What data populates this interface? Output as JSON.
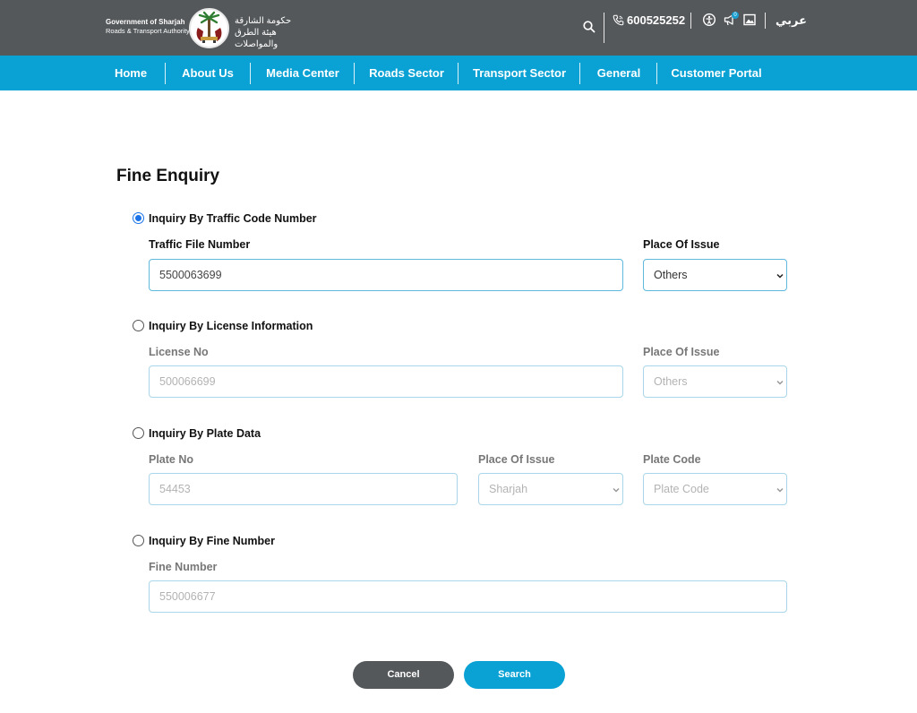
{
  "header": {
    "logo_en_line1": "Government of Sharjah",
    "logo_en_line2": "Roads & Transport Authority",
    "logo_ar_line1": "حكومة الشارقة",
    "logo_ar_line2": "هيئة الطرق والمواصلات",
    "phone": "600525252",
    "notification_count": "0",
    "language": "عربي",
    "icons": [
      "search-icon",
      "phone-icon",
      "accessibility-icon",
      "megaphone-icon",
      "image-icon"
    ]
  },
  "nav": {
    "items": [
      "Home",
      "About Us",
      "Media Center",
      "Roads Sector",
      "Transport Sector",
      "General",
      "Customer Portal"
    ]
  },
  "form": {
    "title": "Fine Enquiry",
    "option_traffic_code": {
      "label": "Inquiry By Traffic Code Number",
      "selected": true,
      "file_label": "Traffic File Number",
      "file_value": "5500063699",
      "place_label": "Place Of Issue",
      "place_value": "Others"
    },
    "option_license": {
      "label": "Inquiry By License Information",
      "selected": false,
      "license_label": "License No",
      "license_placeholder": "500066699",
      "place_label": "Place Of Issue",
      "place_value": "Others"
    },
    "option_plate": {
      "label": "Inquiry By Plate Data",
      "selected": false,
      "plate_label": "Plate No",
      "plate_placeholder": "54453",
      "place_label": "Place Of Issue",
      "place_value": "Sharjah",
      "code_label": "Plate Code",
      "code_value": "Plate Code"
    },
    "option_fine": {
      "label": "Inquiry By Fine Number",
      "selected": false,
      "fine_label": "Fine Number",
      "fine_placeholder": "550006677"
    },
    "cancel_label": "Cancel",
    "search_label": "Search"
  },
  "colors": {
    "topbar": "#54585b",
    "accent": "#0aa2d4",
    "field_border": "#5fb8dd"
  }
}
